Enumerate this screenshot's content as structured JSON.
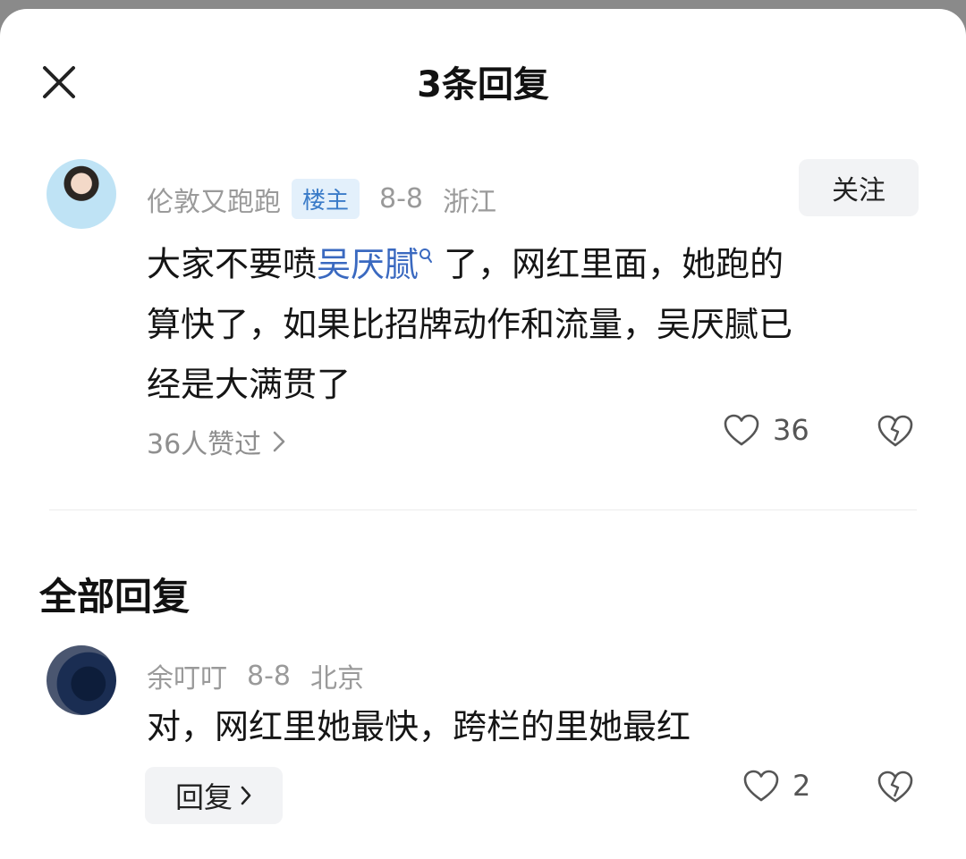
{
  "header": {
    "title": "3条回复",
    "close_icon": "close-icon"
  },
  "main_comment": {
    "author": "伦敦又跑跑",
    "badge": "楼主",
    "date": "8-8",
    "location": "浙江",
    "follow_label": "关注",
    "text_before": "大家不要喷",
    "mention": "吴厌腻",
    "text_after_line1": "了，网红里面，她跑的",
    "text_line2": "算快了，如果比招牌动作和流量，吴厌腻已",
    "text_line3": "经是大满贯了",
    "likers_label": "36人赞过",
    "like_count": "36"
  },
  "section": {
    "title": "全部回复"
  },
  "replies": [
    {
      "author": "余叮叮",
      "date": "8-8",
      "location": "北京",
      "text": "对，网红里她最快，跨栏的里她最红",
      "reply_label": "回复",
      "like_count": "2"
    }
  ],
  "colors": {
    "mention": "#3a69c0",
    "badge_bg": "#e3f0fb",
    "badge_text": "#3a7bc8"
  }
}
